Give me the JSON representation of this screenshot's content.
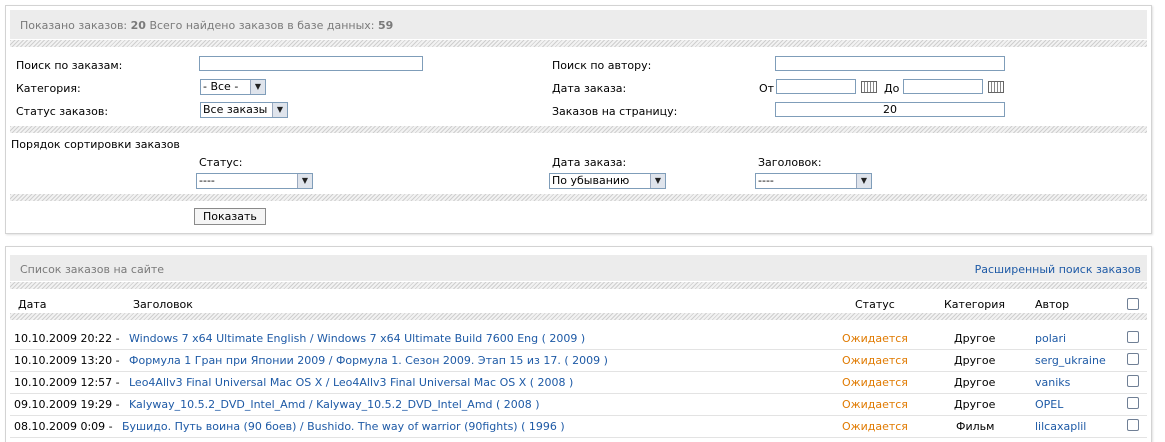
{
  "filter": {
    "shown_label": "Показано заказов:",
    "shown_count": "20",
    "total_label": "Всего найдено заказов в базе данных:",
    "total_count": "59",
    "search_orders_label": "Поиск по заказам:",
    "search_orders_value": "",
    "search_author_label": "Поиск по автору:",
    "search_author_value": "",
    "category_label": "Категория:",
    "category_value": "- Все -",
    "order_date_label": "Дата заказа:",
    "from_label": "От",
    "from_value": "",
    "to_label": "До",
    "to_value": "",
    "status_label": "Статус заказов:",
    "status_value": "Все заказы",
    "per_page_label": "Заказов на страницу:",
    "per_page_value": "20",
    "sort_title": "Порядок сортировки заказов",
    "sort_status_label": "Статус:",
    "sort_status_value": "----",
    "sort_date_label": "Дата заказа:",
    "sort_date_value": "По убыванию",
    "sort_title_label": "Заголовок:",
    "sort_title_value": "----",
    "show_button": "Показать"
  },
  "list": {
    "title": "Список заказов на сайте",
    "advanced_search": "Расширенный поиск заказов",
    "columns": {
      "date": "Дата",
      "title": "Заголовок",
      "status": "Статус",
      "category": "Категория",
      "author": "Автор"
    },
    "rows": [
      {
        "date": "10.10.2009 20:22 -",
        "title": "Windows 7 x64 Ultimate English / Windows 7 x64 Ultimate Build 7600 Eng ( 2009 )",
        "status": "Ожидается",
        "category": "Другое",
        "author": "polari"
      },
      {
        "date": "10.10.2009 13:20 -",
        "title": "Формула 1 Гран при Японии 2009 / Формула 1. Сезон 2009. Этап 15 из 17. ( 2009 )",
        "status": "Ожидается",
        "category": "Другое",
        "author": "serg_ukraine"
      },
      {
        "date": "10.10.2009 12:57 -",
        "title": "Leo4Allv3 Final Universal Mac OS X / Leo4Allv3 Final Universal Mac OS X ( 2008 )",
        "status": "Ожидается",
        "category": "Другое",
        "author": "vaniks"
      },
      {
        "date": "09.10.2009 19:29 -",
        "title": "Kalyway_10.5.2_DVD_Intel_Amd / Kalyway_10.5.2_DVD_Intel_Amd ( 2008 )",
        "status": "Ожидается",
        "category": "Другое",
        "author": "OPEL"
      },
      {
        "date": "08.10.2009 0:09 -",
        "title": "Бушидо. Путь воина (90 боев) / Bushido. The way of warrior (90fights) ( 1996 )",
        "status": "Ожидается",
        "category": "Фильм",
        "author": "lilcaxaplil"
      }
    ]
  }
}
